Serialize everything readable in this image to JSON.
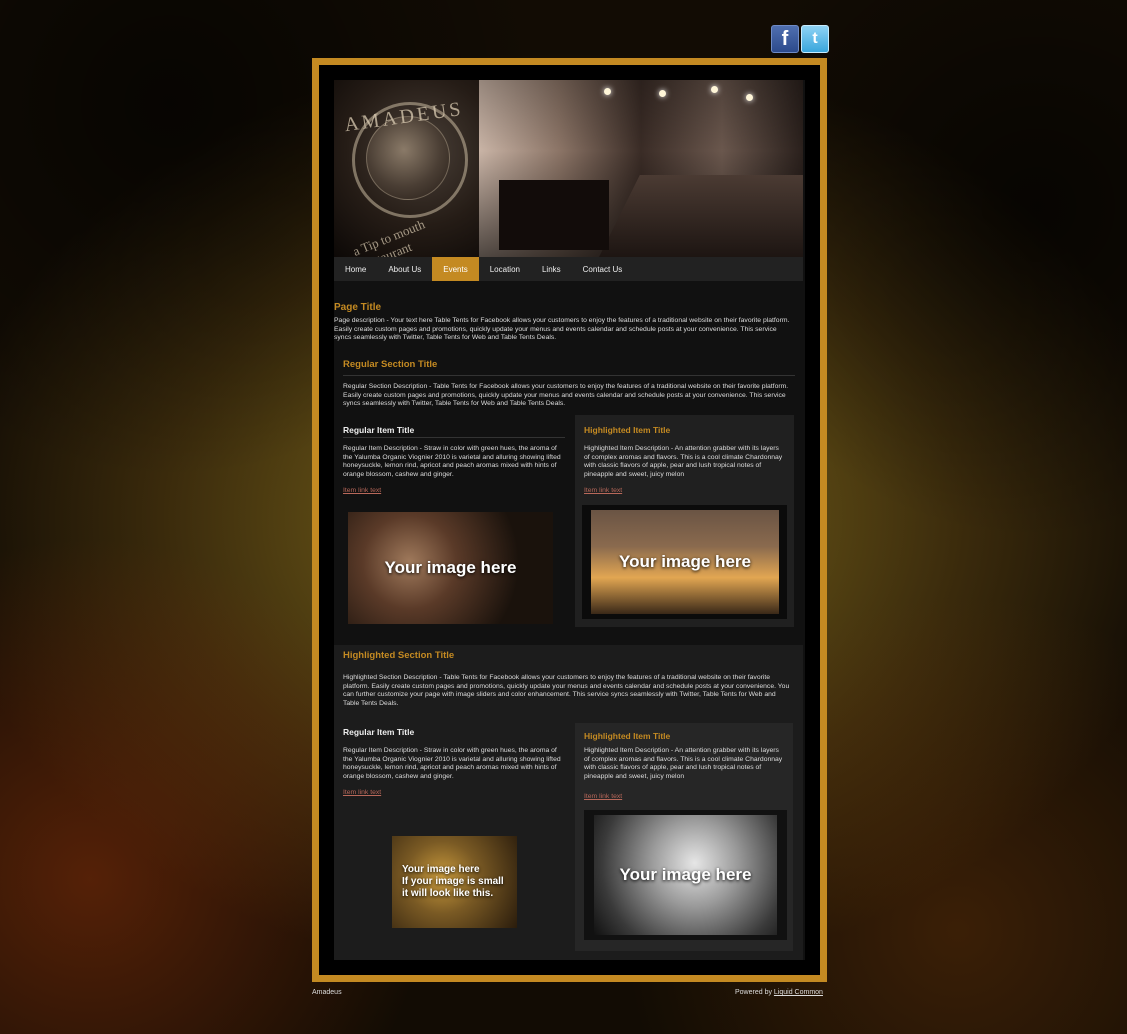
{
  "social": {
    "facebook_icon": "facebook-icon",
    "twitter_icon": "twitter-icon"
  },
  "header": {
    "logo_text": "AMADEUS",
    "logo_subtext": "a Tip to mouth Restaurant"
  },
  "nav": {
    "items": [
      {
        "label": "Home"
      },
      {
        "label": "About Us"
      },
      {
        "label": "Events"
      },
      {
        "label": "Location"
      },
      {
        "label": "Links"
      },
      {
        "label": "Contact Us"
      }
    ],
    "active": "Events"
  },
  "page": {
    "title": "Page Title",
    "description": "Page description - Your text here Table Tents for Facebook allows your customers to enjoy the features of a traditional website on their favorite platform. Easily create custom pages and promotions, quickly update your menus and events calendar and schedule posts at your convenience. This service syncs seamlessly with Twitter, Table Tents for Web and Table Tents Deals."
  },
  "regular_section": {
    "title": "Regular Section Title",
    "description": "Regular Section Description -  Table Tents for Facebook allows your customers to enjoy the features of a traditional website on their favorite platform. Easily create custom pages and promotions, quickly update your menus and events calendar and schedule posts at your convenience. This service syncs seamlessly with Twitter, Table Tents for Web and Table Tents Deals.",
    "regular_item": {
      "title": "Regular Item Title",
      "description": "Regular Item Description - Straw in color with green hues, the aroma of the Yalumba Organic Viognier 2010 is varietal and alluring showing lifted honeysuckle, lemon rind, apricot and peach aromas mixed with hints of orange blossom, cashew and ginger.",
      "link": "Item link text",
      "image_caption": "Your image here"
    },
    "highlighted_item": {
      "title": "Highlighted Item Title",
      "description": "Highlighted Item Description - An attention grabber with its layers of complex aromas and flavors. This is a cool climate Chardonnay with classic flavors of apple, pear and lush tropical notes of pineapple and sweet, juicy melon",
      "link": "Item link text",
      "image_caption": "Your image here"
    }
  },
  "highlighted_section": {
    "title": "Highlighted Section Title",
    "description": "Highlighted Section Description - Table Tents for Facebook allows your customers to enjoy the features of a traditional website on their favorite platform. Easily create custom pages and promotions, quickly update your menus and events calendar and schedule posts at your convenience. You can further customize your page with image sliders and color enhancement. This service syncs seamlessly with Twitter, Table Tents for Web and Table Tents Deals.",
    "regular_item": {
      "title": "Regular Item Title",
      "description": "Regular Item Description - Straw in color with green hues, the aroma of the Yalumba Organic Viognier 2010 is varietal and alluring showing lifted honeysuckle, lemon rind, apricot and peach aromas mixed with hints of orange blossom, cashew and ginger.",
      "link": "Item link text",
      "image_caption_line1": "Your image here",
      "image_caption_line2": "If your image is small",
      "image_caption_line3": "it will look like this."
    },
    "highlighted_item": {
      "title": "Highlighted Item Title",
      "description": "Highlighted Item Description - An attention grabber with its layers of complex aromas and flavors. This is a cool climate Chardonnay with classic flavors of apple, pear and lush tropical notes of pineapple and sweet, juicy melon",
      "link": "Item link text",
      "image_caption": "Your image here"
    }
  },
  "footer": {
    "left": "Amadeus",
    "powered_prefix": "Powered by",
    "powered_link": "Liquid Common"
  },
  "colors": {
    "accent": "#c48a22",
    "link": "#b9685a",
    "background": "#111111"
  }
}
